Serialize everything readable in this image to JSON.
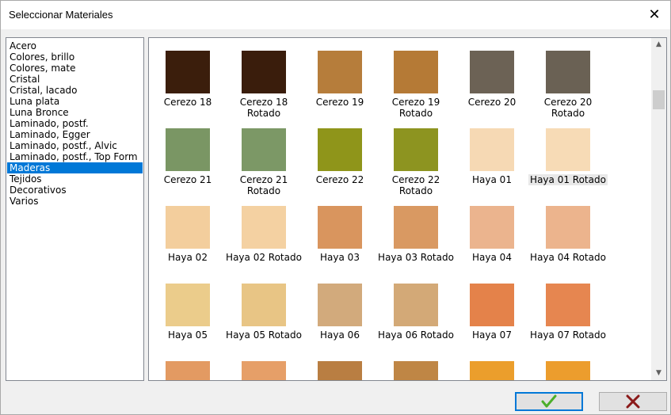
{
  "window": {
    "title": "Seleccionar Materiales",
    "close_glyph": "✕"
  },
  "categories": [
    "Acero",
    "Colores, brillo",
    "Colores, mate",
    "Cristal",
    "Cristal, lacado",
    "Luna plata",
    "Luna Bronce",
    "Laminado, postf.",
    "Laminado, Egger",
    "Laminado, postf., Alvic",
    "Laminado, postf., Top Form",
    "Maderas",
    "Tejidos",
    "Decorativos",
    "Varios"
  ],
  "selected_category": "Maderas",
  "materials": [
    {
      "name": "Cerezo 18",
      "color": "#3b1e0c"
    },
    {
      "name": "Cerezo 18\nRotado",
      "color": "#3a1d0c"
    },
    {
      "name": "Cerezo 19",
      "color": "#b67d3b"
    },
    {
      "name": "Cerezo 19\nRotado",
      "color": "#b57a36"
    },
    {
      "name": "Cerezo 20",
      "color": "#6c6255"
    },
    {
      "name": "Cerezo 20\nRotado",
      "color": "#6a6154"
    },
    {
      "name": "Cerezo 21",
      "color": "#7a9664"
    },
    {
      "name": "Cerezo 21\nRotado",
      "color": "#7c9866"
    },
    {
      "name": "Cerezo 22",
      "color": "#8f951a"
    },
    {
      "name": "Cerezo 22\nRotado",
      "color": "#8d9420"
    },
    {
      "name": "Haya 01",
      "color": "#f6d9b4"
    },
    {
      "name": "Haya 01 Rotado",
      "color": "#f7dbb6"
    },
    {
      "name": "Haya 02",
      "color": "#f3ce9d"
    },
    {
      "name": "Haya 02 Rotado",
      "color": "#f4d1a2"
    },
    {
      "name": "Haya 03",
      "color": "#d9955e"
    },
    {
      "name": "Haya 03 Rotado",
      "color": "#d99962"
    },
    {
      "name": "Haya 04",
      "color": "#ebb48e"
    },
    {
      "name": "Haya 04 Rotado",
      "color": "#ecb48d"
    },
    {
      "name": "Haya 05",
      "color": "#ebcc8b"
    },
    {
      "name": "Haya 05 Rotado",
      "color": "#e8c585"
    },
    {
      "name": "Haya 06",
      "color": "#d2aa7c"
    },
    {
      "name": "Haya 06 Rotado",
      "color": "#d3a977"
    },
    {
      "name": "Haya 07",
      "color": "#e4824a"
    },
    {
      "name": "Haya 07 Rotado",
      "color": "#e68650"
    },
    {
      "name": "",
      "color": "#e39a62"
    },
    {
      "name": "",
      "color": "#e69f68"
    },
    {
      "name": "",
      "color": "#b97e42"
    },
    {
      "name": "",
      "color": "#bf8645"
    },
    {
      "name": "",
      "color": "#eb9e2c"
    },
    {
      "name": "",
      "color": "#ec9d2d"
    }
  ],
  "focused_material": "Haya 01 Rotado",
  "scrollbar": {
    "up_glyph": "▲",
    "down_glyph": "▼"
  },
  "buttons": {
    "ok_icon": "check-icon",
    "cancel_icon": "x-icon",
    "ok_color": "#4caf2a",
    "cancel_color": "#8b1a1a"
  }
}
